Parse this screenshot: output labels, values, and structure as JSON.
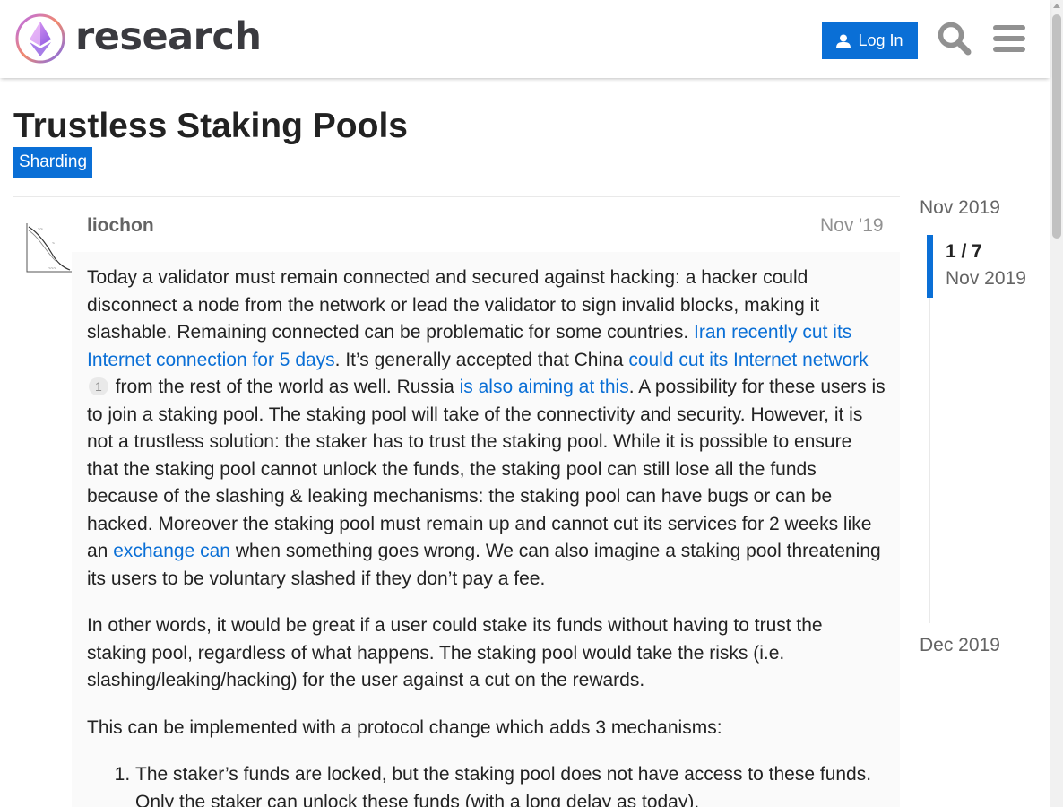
{
  "header": {
    "logo_text": "research",
    "login_label": "Log In"
  },
  "topic": {
    "title": "Trustless Staking Pools",
    "category": "Sharding"
  },
  "post": {
    "author": "liochon",
    "date": "Nov '19",
    "p1": {
      "t1": "Today a validator must remain connected and secured against hacking: a hacker could disconnect a node from the network or lead the validator to sign invalid blocks, making it slashable. Remaining connected can be problematic for some countries. ",
      "link1": "Iran recently cut its Internet connection for 5 days",
      "t2": ". It’s generally accepted that China ",
      "link2": "could cut its Internet network",
      "clicks2": "1",
      "t3": " from the rest of the world as well. Russia ",
      "link3": "is also aiming at this",
      "t4": ". A possibility for these users is to join a staking pool. The staking pool will take of the connectivity and security. However, it is not a trustless solution: the staker has to trust the staking pool. While it is possible to ensure that the staking pool cannot unlock the funds, the staking pool can still lose all the funds because of the slashing & leaking mechanisms: the staking pool can have bugs or can be hacked. Moreover the staking pool must remain up and cannot cut its services for 2 weeks like an ",
      "link4": "exchange can",
      "t5": " when something goes wrong. We can also imagine a staking pool threatening its users to be voluntary slashed if they don’t pay a fee."
    },
    "p2": "In other words, it would be great if a user could stake its funds without having to trust the staking pool, regardless of what happens. The staking pool would take the risks (i.e. slashing/leaking/hacking) for the user against a cut on the rewards.",
    "p3": "This can be implemented with a protocol change which adds 3 mechanisms:",
    "list": [
      "The staker’s funds are locked, but the staking pool does not have access to these funds. Only the staker can unlock these funds (with a long delay as today)."
    ]
  },
  "timeline": {
    "start": "Nov 2019",
    "position": "1 / 7",
    "current_date": "Nov 2019",
    "end": "Dec 2019"
  },
  "colors": {
    "accent": "#0a6fd6",
    "text": "#222222",
    "muted": "#919191"
  }
}
